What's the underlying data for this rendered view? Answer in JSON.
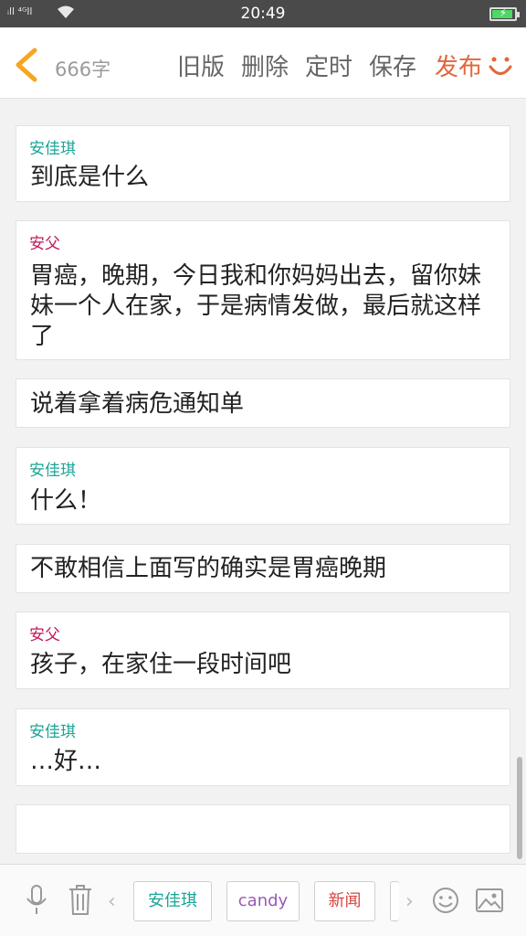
{
  "status_bar": {
    "signal_text": "ᵢll ⁴ᴳll",
    "time": "20:49",
    "battery_level": 0.9
  },
  "toolbar": {
    "word_count": "666字",
    "old_version": "旧版",
    "delete": "删除",
    "schedule": "定时",
    "save": "保存",
    "publish": "发布",
    "back_icon": "chevron-left-icon",
    "mood_icon": "smile-icon"
  },
  "colors": {
    "accent": "#e2663b",
    "teal_speaker": "#1aa597",
    "magenta_speaker": "#c2185b"
  },
  "story": {
    "cards": [
      {
        "speaker": "安佳琪",
        "text": "到底是什么"
      },
      {
        "speaker": "安父",
        "text": "胃癌，晚期，今日我和你妈妈出去，留你妹妹一个人在家，于是病情发做，最后就这样了"
      },
      {
        "speaker": "",
        "text": "说着拿着病危通知单"
      },
      {
        "speaker": "安佳琪",
        "text": "什么！"
      },
      {
        "speaker": "",
        "text": "不敢相信上面写的确实是胃癌晚期"
      },
      {
        "speaker": "安父",
        "text": "孩子，在家住一段时间吧"
      },
      {
        "speaker": "安佳琪",
        "text": "…好…"
      },
      {
        "speaker": "",
        "text": ""
      }
    ]
  },
  "bottom_bar": {
    "chips": [
      "安佳琪",
      "candy",
      "新闻"
    ],
    "icons": [
      "microphone-icon",
      "trash-icon",
      "emoji-icon",
      "image-icon"
    ]
  }
}
